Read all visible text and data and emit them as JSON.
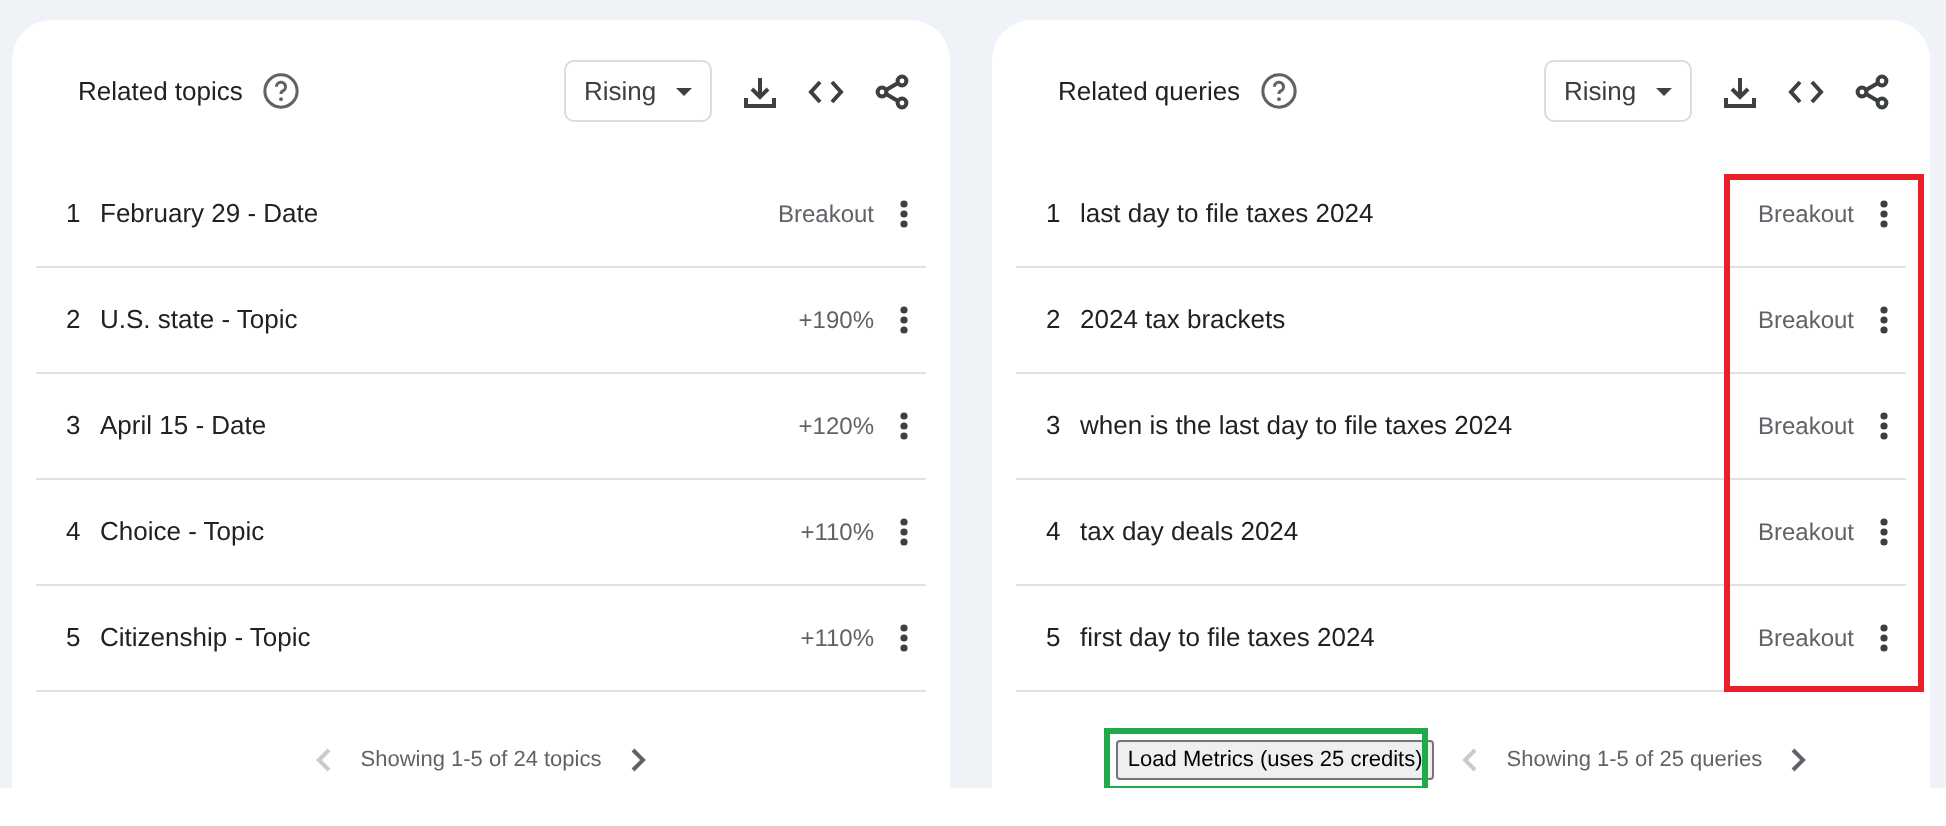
{
  "panels": [
    {
      "title": "Related topics",
      "filter": "Rising",
      "rows": [
        {
          "rank": "1",
          "label": "February 29 - Date",
          "value": "Breakout"
        },
        {
          "rank": "2",
          "label": "U.S. state - Topic",
          "value": "+190%"
        },
        {
          "rank": "3",
          "label": "April 15 - Date",
          "value": "+120%"
        },
        {
          "rank": "4",
          "label": "Choice - Topic",
          "value": "+110%"
        },
        {
          "rank": "5",
          "label": "Citizenship - Topic",
          "value": "+110%"
        }
      ],
      "pager": {
        "text": "Showing 1-5 of 24 topics",
        "prev_disabled": true,
        "next_disabled": false
      }
    },
    {
      "title": "Related queries",
      "filter": "Rising",
      "frames": [
        {
          "kind": "values",
          "color": "#e8202a"
        },
        {
          "kind": "button",
          "color": "#22a94a"
        }
      ],
      "rows": [
        {
          "rank": "1",
          "label": "last day to file taxes 2024",
          "value": "Breakout"
        },
        {
          "rank": "2",
          "label": "2024 tax brackets",
          "value": "Breakout"
        },
        {
          "rank": "3",
          "label": "when is the last day to file taxes 2024",
          "value": "Breakout"
        },
        {
          "rank": "4",
          "label": "tax day deals 2024",
          "value": "Breakout"
        },
        {
          "rank": "5",
          "label": "first day to file taxes 2024",
          "value": "Breakout"
        }
      ],
      "load_button": {
        "label": "Load Metrics (uses 25 credits)"
      },
      "pager": {
        "text": "Showing 1-5 of 25 queries",
        "prev_disabled": true,
        "next_disabled": false
      }
    }
  ]
}
